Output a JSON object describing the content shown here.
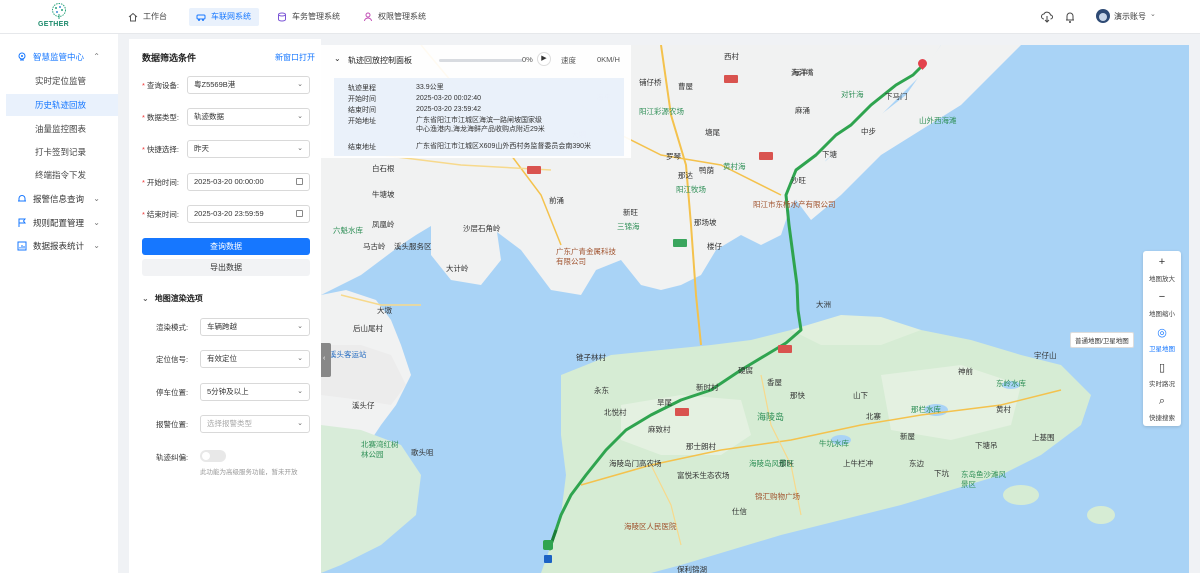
{
  "brand": {
    "logo_text": "GETHER"
  },
  "nav": {
    "tabs": [
      {
        "label": "工作台",
        "icon": "home-icon"
      },
      {
        "label": "车联网系统",
        "icon": "car-icon",
        "active": true
      },
      {
        "label": "车务管理系统",
        "icon": "database-icon"
      },
      {
        "label": "权限管理系统",
        "icon": "user-icon"
      }
    ],
    "user": "演示账号"
  },
  "sidebar": {
    "group_main": "智慧监管中心",
    "items": [
      {
        "label": "实时定位监管"
      },
      {
        "label": "历史轨迹回放",
        "active": true
      },
      {
        "label": "油量监控图表"
      },
      {
        "label": "打卡签到记录"
      },
      {
        "label": "终端指令下发"
      }
    ],
    "groups": [
      {
        "label": "报警信息查询"
      },
      {
        "label": "规则配置管理"
      },
      {
        "label": "数据报表统计"
      }
    ]
  },
  "filter": {
    "title": "数据筛选条件",
    "new_window": "新窗口打开",
    "fields": {
      "device": {
        "label": "查询设备:",
        "value": "粤Z5569B港"
      },
      "data_type": {
        "label": "数据类型:",
        "value": "轨迹数据"
      },
      "quick": {
        "label": "快捷选择:",
        "value": "昨天"
      },
      "start": {
        "label": "开始时间:",
        "value": "2025-03-20 00:00:00"
      },
      "end": {
        "label": "结束时间:",
        "value": "2025-03-20 23:59:59"
      }
    },
    "query_button": "查询数据",
    "export_button": "导出数据",
    "render_section": "地图渲染选项",
    "render": {
      "mode": {
        "label": "渲染模式:",
        "value": "车辆跨越"
      },
      "signal": {
        "label": "定位信号:",
        "value": "有效定位"
      },
      "stop": {
        "label": "停车位置:",
        "value": "5分钟及以上"
      },
      "alarm": {
        "label": "报警位置:",
        "placeholder": "选择报警类型"
      },
      "correct": {
        "label": "轨迹纠偏:"
      }
    },
    "hint": "此功能为高级服务功能，暂未开放"
  },
  "playback": {
    "title": "轨迹回放控制面板",
    "progress_pct": "0%",
    "progress_fraction": 0.0,
    "speed_label": "速度",
    "speed_value": "0KM/H",
    "info": [
      {
        "label": "轨迹里程",
        "value": "33.9公里"
      },
      {
        "label": "开始时间",
        "value": "2025-03-20 00:02:40"
      },
      {
        "label": "结束时间",
        "value": "2025-03-20 23:59:42"
      },
      {
        "label": "开始地址",
        "value": "广东省阳江市江城区海滨一路闸坡国家级中心渔港内,海龙海鲜产品收购点附近29米"
      },
      {
        "label": "结束地址",
        "value": "广东省阳江市江城区X609山外西村务监督委员会南390米"
      }
    ]
  },
  "map_tools": [
    {
      "label": "地图放大",
      "icon": "zoom-in-icon"
    },
    {
      "label": "地图缩小",
      "icon": "zoom-out-icon"
    },
    {
      "label": "卫星地图",
      "icon": "satellite-icon",
      "active": true
    },
    {
      "label": "实时路况",
      "icon": "traffic-icon"
    },
    {
      "label": "快捷搜索",
      "icon": "search-icon"
    }
  ],
  "map_tooltip": "普通地图/卫星地图",
  "map_labels": [
    "西村",
    "铺仔桥",
    "曹屋",
    "阳江彩源农场",
    "海平",
    "大垌",
    "塘尾",
    "海洋",
    "罗琴",
    "鸭荫",
    "那达",
    "黄村海",
    "阳江牧场",
    "沙旺",
    "阳江市东杨水产有限公司",
    "新旺",
    "前涌",
    "三锦海",
    "那场坡",
    "下塘",
    "中步",
    "山外西海滩",
    "对针海",
    "下马门",
    "麻涌",
    "海洋嘴",
    "大洲",
    "白石根",
    "牛塘坡",
    "凤凰岭",
    "六魁水库",
    "马古岭",
    "溪头服务区",
    "大计岭",
    "沙层石角岭",
    "大墩",
    "后山尾村",
    "溪头客运站",
    "溪头仔",
    "北赛湾红树林公园",
    "歌头咀",
    "广东广青金属科技有限公司",
    "楼仔",
    "锥子林村",
    "永东",
    "北悦村",
    "旱尾",
    "麻致村",
    "新时村",
    "硬腐",
    "香屋",
    "海陵岛",
    "那快",
    "山下",
    "北寨",
    "牛坑水库",
    "那栏水库",
    "黄村",
    "东岭水库",
    "宇仔山",
    "神前",
    "上基围",
    "下塘吊",
    "那旺",
    "那士朗村",
    "上牛栏冲",
    "新屋",
    "东边",
    "下坑",
    "东岛鱼沙滩风景区",
    "海陵岛门高农场",
    "海陵岛风景区",
    "富悦禾生态农场",
    "锦汇购物广场",
    "仕信",
    "海陵区人民医院",
    "保利锦湖"
  ]
}
